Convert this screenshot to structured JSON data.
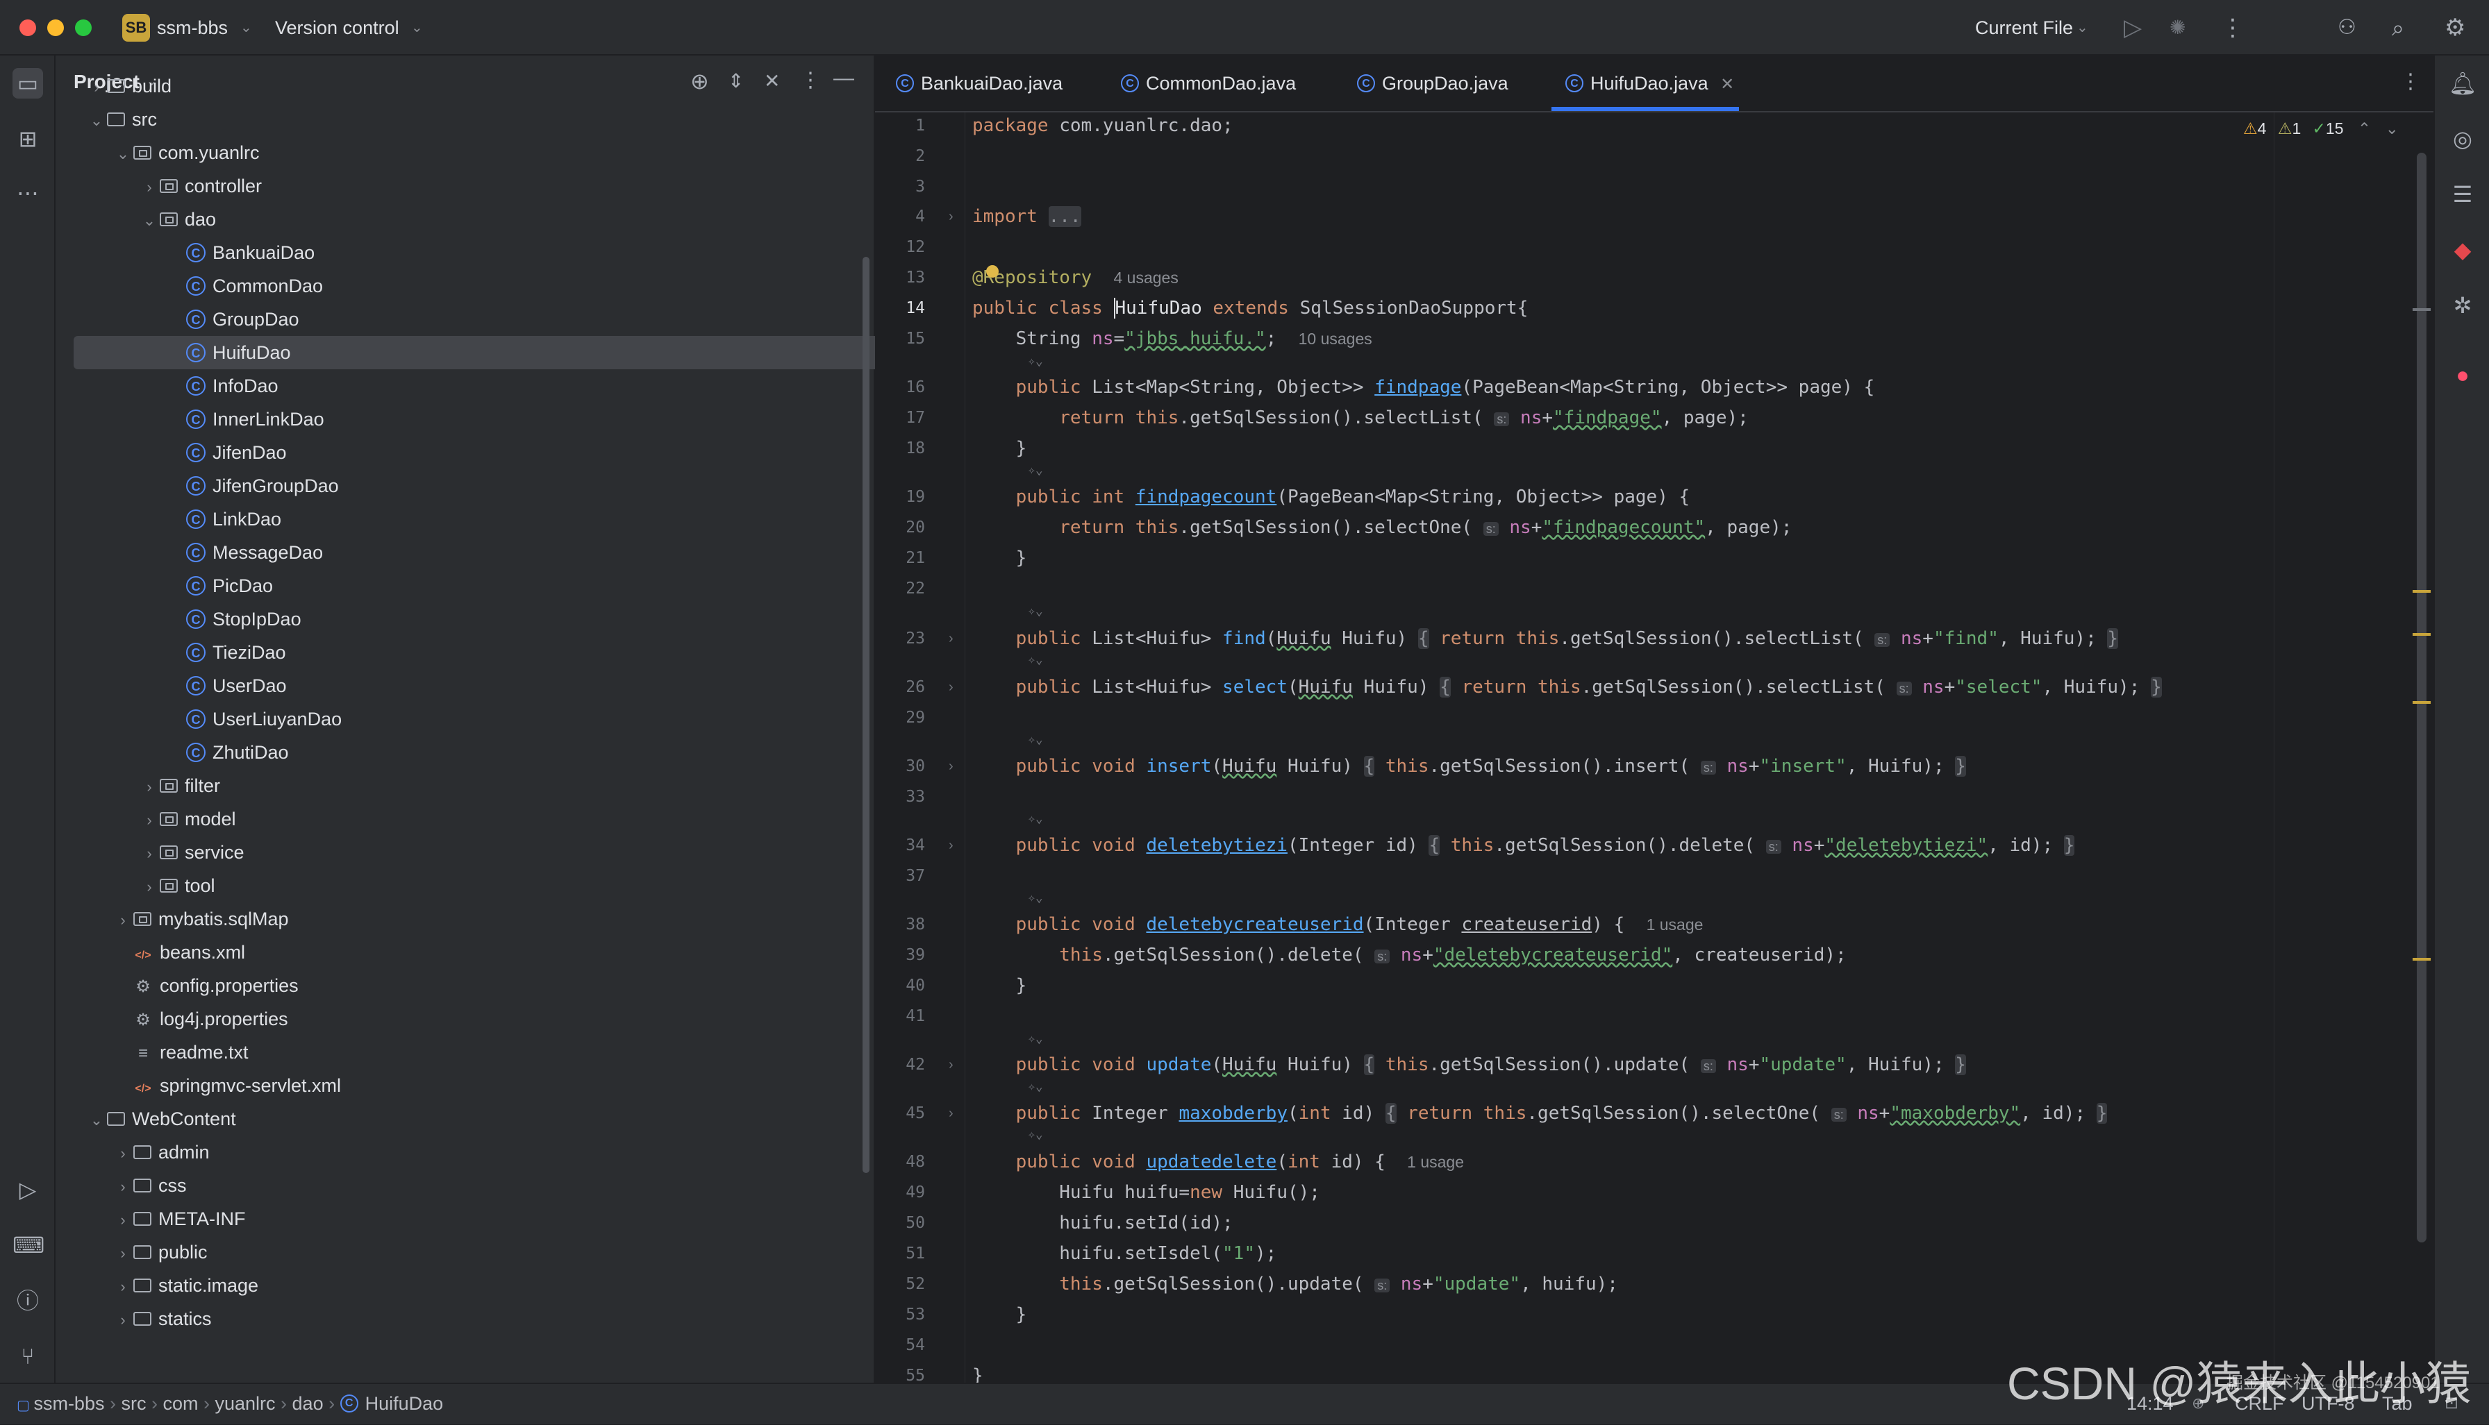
{
  "titlebar": {
    "project_badge": "SB",
    "project_name": "ssm-bbs",
    "vcs": "Version control",
    "run_config": "Current File"
  },
  "project_panel": {
    "title": "Project",
    "tree": [
      {
        "label": "build",
        "icon": "folder-icon",
        "depth": 1,
        "chevron": "›",
        "sel": false
      },
      {
        "label": "src",
        "icon": "folder-icon",
        "depth": 1,
        "chevron": "⌄",
        "sel": false
      },
      {
        "label": "com.yuanlrc",
        "icon": "package-icon",
        "depth": 2,
        "chevron": "⌄",
        "sel": false
      },
      {
        "label": "controller",
        "icon": "package-icon",
        "depth": 3,
        "chevron": "›",
        "sel": false
      },
      {
        "label": "dao",
        "icon": "package-icon",
        "depth": 3,
        "chevron": "⌄",
        "sel": false
      },
      {
        "label": "BankuaiDao",
        "icon": "class-icon",
        "depth": 4,
        "chevron": "",
        "sel": false
      },
      {
        "label": "CommonDao",
        "icon": "class-icon",
        "depth": 4,
        "chevron": "",
        "sel": false
      },
      {
        "label": "GroupDao",
        "icon": "class-icon",
        "depth": 4,
        "chevron": "",
        "sel": false
      },
      {
        "label": "HuifuDao",
        "icon": "class-icon",
        "depth": 4,
        "chevron": "",
        "sel": true
      },
      {
        "label": "InfoDao",
        "icon": "class-icon",
        "depth": 4,
        "chevron": "",
        "sel": false
      },
      {
        "label": "InnerLinkDao",
        "icon": "class-icon",
        "depth": 4,
        "chevron": "",
        "sel": false
      },
      {
        "label": "JifenDao",
        "icon": "class-icon",
        "depth": 4,
        "chevron": "",
        "sel": false
      },
      {
        "label": "JifenGroupDao",
        "icon": "class-icon",
        "depth": 4,
        "chevron": "",
        "sel": false
      },
      {
        "label": "LinkDao",
        "icon": "class-icon",
        "depth": 4,
        "chevron": "",
        "sel": false
      },
      {
        "label": "MessageDao",
        "icon": "class-icon",
        "depth": 4,
        "chevron": "",
        "sel": false
      },
      {
        "label": "PicDao",
        "icon": "class-icon",
        "depth": 4,
        "chevron": "",
        "sel": false
      },
      {
        "label": "StopIpDao",
        "icon": "class-icon",
        "depth": 4,
        "chevron": "",
        "sel": false
      },
      {
        "label": "TieziDao",
        "icon": "class-icon",
        "depth": 4,
        "chevron": "",
        "sel": false
      },
      {
        "label": "UserDao",
        "icon": "class-icon",
        "depth": 4,
        "chevron": "",
        "sel": false
      },
      {
        "label": "UserLiuyanDao",
        "icon": "class-icon",
        "depth": 4,
        "chevron": "",
        "sel": false
      },
      {
        "label": "ZhutiDao",
        "icon": "class-icon",
        "depth": 4,
        "chevron": "",
        "sel": false
      },
      {
        "label": "filter",
        "icon": "package-icon",
        "depth": 3,
        "chevron": "›",
        "sel": false
      },
      {
        "label": "model",
        "icon": "package-icon",
        "depth": 3,
        "chevron": "›",
        "sel": false
      },
      {
        "label": "service",
        "icon": "package-icon",
        "depth": 3,
        "chevron": "›",
        "sel": false
      },
      {
        "label": "tool",
        "icon": "package-icon",
        "depth": 3,
        "chevron": "›",
        "sel": false
      },
      {
        "label": "mybatis.sqlMap",
        "icon": "package-icon",
        "depth": 2,
        "chevron": "›",
        "sel": false
      },
      {
        "label": "beans.xml",
        "icon": "xml-icon",
        "depth": 2,
        "chevron": "",
        "sel": false
      },
      {
        "label": "config.properties",
        "icon": "properties-icon",
        "depth": 2,
        "chevron": "",
        "sel": false
      },
      {
        "label": "log4j.properties",
        "icon": "properties-icon",
        "depth": 2,
        "chevron": "",
        "sel": false
      },
      {
        "label": "readme.txt",
        "icon": "text-file-icon",
        "depth": 2,
        "chevron": "",
        "sel": false
      },
      {
        "label": "springmvc-servlet.xml",
        "icon": "xml-icon",
        "depth": 2,
        "chevron": "",
        "sel": false
      },
      {
        "label": "WebContent",
        "icon": "folder-icon",
        "depth": 1,
        "chevron": "⌄",
        "sel": false
      },
      {
        "label": "admin",
        "icon": "folder-icon",
        "depth": 2,
        "chevron": "›",
        "sel": false
      },
      {
        "label": "css",
        "icon": "folder-icon",
        "depth": 2,
        "chevron": "›",
        "sel": false
      },
      {
        "label": "META-INF",
        "icon": "folder-icon",
        "depth": 2,
        "chevron": "›",
        "sel": false
      },
      {
        "label": "public",
        "icon": "folder-icon",
        "depth": 2,
        "chevron": "›",
        "sel": false
      },
      {
        "label": "static.image",
        "icon": "folder-icon",
        "depth": 2,
        "chevron": "›",
        "sel": false
      },
      {
        "label": "statics",
        "icon": "folder-icon",
        "depth": 2,
        "chevron": "›",
        "sel": false
      }
    ]
  },
  "tabs": [
    {
      "label": "BankuaiDao.java"
    },
    {
      "label": "CommonDao.java"
    },
    {
      "label": "GroupDao.java"
    },
    {
      "label": "HuifuDao.java",
      "active": true
    }
  ],
  "inspections": {
    "warnings": "4",
    "weak": "1",
    "ok": "15"
  },
  "editor": {
    "line_numbers": [
      "1",
      "2",
      "3",
      "4",
      "12",
      "13",
      "14",
      "15",
      "16",
      "17",
      "18",
      "19",
      "20",
      "21",
      "22",
      "23",
      "26",
      "29",
      "30",
      "33",
      "34",
      "37",
      "38",
      "39",
      "40",
      "41",
      "42",
      "45",
      "48",
      "49",
      "50",
      "51",
      "52",
      "53",
      "54",
      "55"
    ],
    "current_line": "14",
    "usages": {
      "repository": "4 usages",
      "ns": "10 usages",
      "deletebycreateuserid": "1 usage",
      "updatedelete": "1 usage"
    },
    "param_hint": "s:",
    "package_line": "com.yuanlrc.dao;",
    "import_fold": "...",
    "annotation": "@Repository",
    "class_name": "HuifuDao",
    "super_class": "SqlSessionDaoSupport{",
    "ns_value": "\"jbbs_huifu.\""
  },
  "breadcrumb": [
    "ssm-bbs",
    "src",
    "com",
    "yuanlrc",
    "dao",
    "HuifuDao"
  ],
  "status": {
    "position": "14:14",
    "line_sep": "CRLF",
    "encoding": "UTF-8",
    "indent": "Tab"
  },
  "watermark": {
    "main": "CSDN @猿来入此小猿",
    "small": "掘金技术社区 @1154520901"
  }
}
